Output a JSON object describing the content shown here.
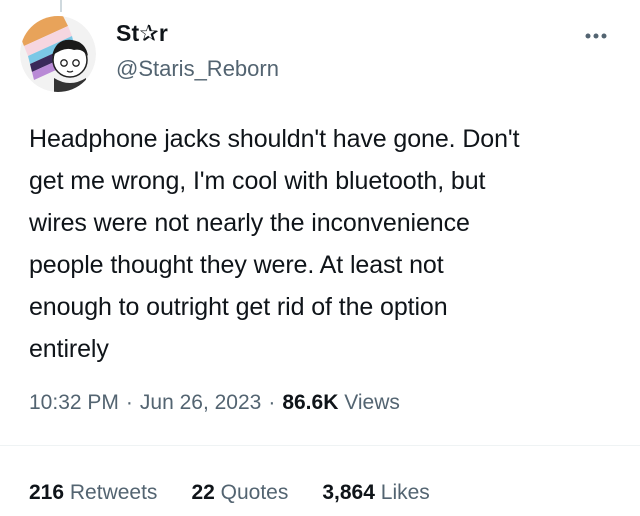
{
  "author": {
    "display_name": "St✰r",
    "handle": "@Staris_Reborn",
    "avatar_icon": "avatar-image"
  },
  "tweet": {
    "lines": [
      "Headphone jacks shouldn't have gone. Don't",
      "get me wrong, I'm cool with bluetooth, but",
      "wires were not nearly the inconvenience",
      "people thought they were. At least not",
      "enough to outright get rid of the option",
      "entirely"
    ]
  },
  "meta": {
    "time": "10:32 PM",
    "separator": "·",
    "date": "Jun 26, 2023",
    "views_count": "86.6K",
    "views_label": "Views"
  },
  "stats": {
    "retweets": {
      "count": "216",
      "label": "Retweets"
    },
    "quotes": {
      "count": "22",
      "label": "Quotes"
    },
    "likes": {
      "count": "3,864",
      "label": "Likes"
    }
  },
  "icons": {
    "more": "more-dots-icon"
  },
  "colors": {
    "text_primary": "#0f1419",
    "text_secondary": "#536471",
    "divider": "#eff3f4",
    "background": "#ffffff"
  }
}
